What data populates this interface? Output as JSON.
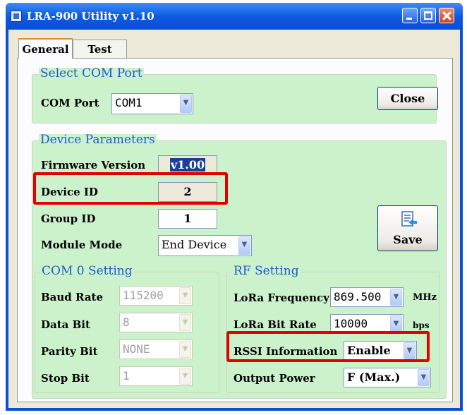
{
  "window": {
    "title": "LRA-900 Utility v1.10"
  },
  "tabs": [
    {
      "label": "General"
    },
    {
      "label": "Test"
    }
  ],
  "com_port": {
    "legend": "Select COM Port",
    "label": "COM Port",
    "value": "COM1",
    "close_label": "Close"
  },
  "device": {
    "legend": "Device Parameters",
    "firmware_label": "Firmware Version",
    "firmware_value": "v1.00",
    "device_id_label": "Device ID",
    "device_id_value": "2",
    "group_id_label": "Group ID",
    "group_id_value": "1",
    "module_mode_label": "Module Mode",
    "module_mode_value": "End Device",
    "save_label": "Save"
  },
  "com0": {
    "legend": "COM 0 Setting",
    "baud_label": "Baud Rate",
    "baud_value": "115200",
    "databit_label": "Data Bit",
    "databit_value": "8",
    "parity_label": "Parity Bit",
    "parity_value": "NONE",
    "stopbit_label": "Stop Bit",
    "stopbit_value": "1"
  },
  "rf": {
    "legend": "RF Setting",
    "freq_label": "LoRa Frequency",
    "freq_value": "869.500",
    "freq_unit": "MHz",
    "bitrate_label": "LoRa Bit Rate",
    "bitrate_value": "10000",
    "bitrate_unit": "bps",
    "rssi_label": "RSSI Information",
    "rssi_value": "Enable",
    "power_label": "Output Power",
    "power_value": "F (Max.)"
  },
  "icons": {
    "save": "save-document-icon",
    "dropdown": "chevron-down-icon"
  },
  "colors": {
    "group_bg": "#ccf2cc",
    "legend": "#1d58d0",
    "highlight": "#e00000",
    "titlebar": "#0a4fd6"
  }
}
